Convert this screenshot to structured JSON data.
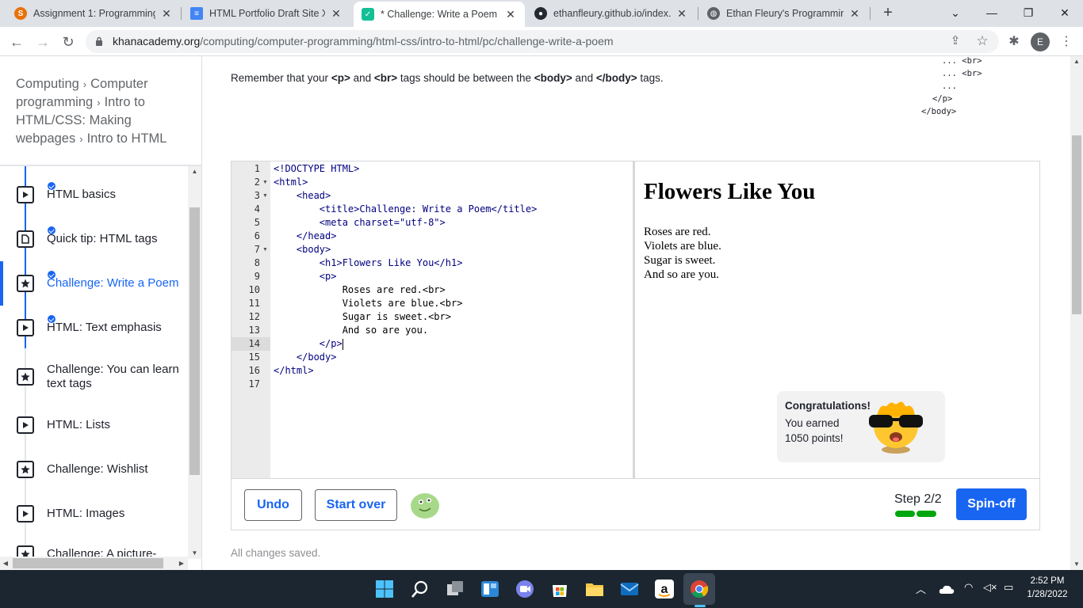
{
  "browser": {
    "tabs": [
      {
        "title": "Assignment 1: Programming",
        "favicon": "schoology-icon",
        "color": "#e8710a"
      },
      {
        "title": "HTML Portfolio Draft Site X",
        "favicon": "docs-icon",
        "color": "#4285f4"
      },
      {
        "title": "* Challenge: Write a Poem | K",
        "favicon": "khan-academy-icon",
        "color": "#14bf96"
      },
      {
        "title": "ethanfleury.github.io/index.h",
        "favicon": "github-icon",
        "color": "#24292f"
      },
      {
        "title": "Ethan Fleury's Programming",
        "favicon": "globe-icon",
        "color": "#5f6368"
      }
    ],
    "new_tab": "+",
    "url_domain": "khanacademy.org",
    "url_path": "/computing/computer-programming/html-css/intro-to-html/pc/challenge-write-a-poem",
    "profile_initial": "E"
  },
  "sidebar": {
    "breadcrumb": [
      "Computing",
      "Computer programming",
      "Intro to HTML/CSS: Making webpages",
      "Intro to HTML"
    ],
    "items": [
      {
        "label": "HTML basics",
        "icon": "play-icon",
        "done": true
      },
      {
        "label": "Quick tip: HTML tags",
        "icon": "document-icon",
        "done": true
      },
      {
        "label": "Challenge: Write a Poem",
        "icon": "star-icon",
        "done": true
      },
      {
        "label": "HTML: Text emphasis",
        "icon": "play-icon",
        "done": true
      },
      {
        "label": "Challenge: You can learn text tags",
        "icon": "star-icon",
        "done": false
      },
      {
        "label": "HTML: Lists",
        "icon": "play-icon",
        "done": false
      },
      {
        "label": "Challenge: Wishlist",
        "icon": "star-icon",
        "done": false
      },
      {
        "label": "HTML: Images",
        "icon": "play-icon",
        "done": false
      },
      {
        "label": "Challenge: A picture-",
        "icon": "star-icon",
        "done": false
      }
    ]
  },
  "instruction": {
    "t1": "Remember that your ",
    "p_tag": "<p>",
    "t2": " and ",
    "br_tag": "<br>",
    "t3": " tags should be between the ",
    "body_open": "<body>",
    "t4": " and ",
    "body_close": "</body>",
    "t5": " tags."
  },
  "snippet": [
    "... <br>",
    "... <br>",
    "...",
    "</p>",
    "</body>"
  ],
  "editor": {
    "lines": [
      {
        "n": "1",
        "text": "<!DOCTYPE HTML>",
        "kind": "tag"
      },
      {
        "n": "2",
        "text": "<html>",
        "kind": "tag",
        "fold": true
      },
      {
        "n": "3",
        "text": "    <head>",
        "kind": "tag",
        "fold": true
      },
      {
        "n": "4",
        "text": "        <title>Challenge: Write a Poem</title>",
        "kind": "tag"
      },
      {
        "n": "5",
        "text": "        <meta charset=\"utf-8\">",
        "kind": "tag"
      },
      {
        "n": "6",
        "text": "    </head>",
        "kind": "tag"
      },
      {
        "n": "7",
        "text": "    <body>",
        "kind": "tag",
        "fold": true
      },
      {
        "n": "8",
        "text": "        <h1>Flowers Like You</h1>",
        "kind": "tag"
      },
      {
        "n": "9",
        "text": "        <p>",
        "kind": "tag"
      },
      {
        "n": "10",
        "text": "            Roses are red.<br>",
        "kind": "txt"
      },
      {
        "n": "11",
        "text": "            Violets are blue.<br>",
        "kind": "txt"
      },
      {
        "n": "12",
        "text": "            Sugar is sweet.<br>",
        "kind": "txt"
      },
      {
        "n": "13",
        "text": "            And so are you.",
        "kind": "txt"
      },
      {
        "n": "14",
        "text": "        </p>",
        "kind": "tag"
      },
      {
        "n": "15",
        "text": "    </body>",
        "kind": "tag"
      },
      {
        "n": "16",
        "text": "</html>",
        "kind": "tag"
      },
      {
        "n": "17",
        "text": "",
        "kind": "tag"
      }
    ],
    "active_line": "14"
  },
  "preview": {
    "heading": "Flowers Like You",
    "poem": [
      "Roses are red.",
      "Violets are blue.",
      "Sugar is sweet.",
      "And so are you."
    ]
  },
  "congrats": {
    "title": "Congratulations!",
    "line1": "You earned",
    "line2": "1050 points!"
  },
  "controls": {
    "undo": "Undo",
    "start_over": "Start over",
    "step": "Step 2/2",
    "spin_off": "Spin-off",
    "status": "All changes saved."
  },
  "taskbar": {
    "time": "2:52 PM",
    "date": "1/28/2022"
  },
  "colors": {
    "accent": "#1865f2",
    "progress": "#00a60e"
  }
}
